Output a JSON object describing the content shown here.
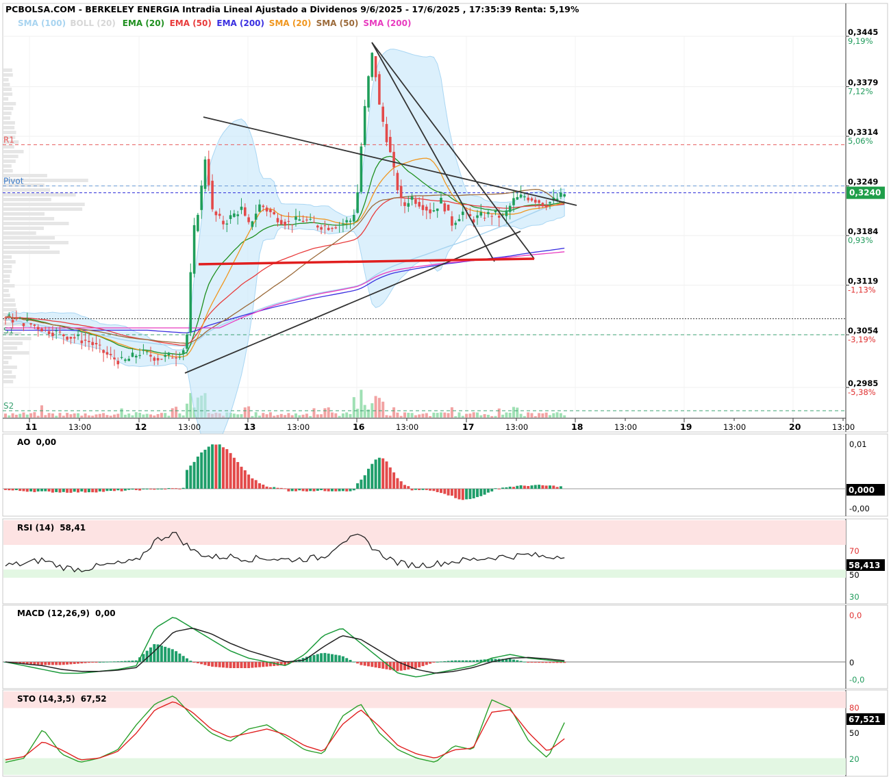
{
  "title": "PCBOLSA.COM - BERKELEY ENERGIA Intradia Lineal Ajustado a Dividenos 9/6/2025 - 17/6/2025 , 17:35:39 Renta: 5,19%",
  "legend": [
    {
      "label": "SMA (100)",
      "color": "#a8d4f0"
    },
    {
      "label": "BOLL (20)",
      "color": "#d7d7d7"
    },
    {
      "label": "EMA (20)",
      "color": "#1e8f1e"
    },
    {
      "label": "EMA (50)",
      "color": "#e83b3b"
    },
    {
      "label": "EMA (200)",
      "color": "#3a2fe0"
    },
    {
      "label": "SMA (20)",
      "color": "#f0961e"
    },
    {
      "label": "SMA (50)",
      "color": "#9b6a3a"
    },
    {
      "label": "SMA (200)",
      "color": "#e83bbf"
    }
  ],
  "price_axis": [
    {
      "value": "0,3445",
      "pct": "9,19%",
      "pct_color": "#1e9a5a"
    },
    {
      "value": "0,3379",
      "pct": "7,12%",
      "pct_color": "#1e9a5a"
    },
    {
      "value": "0,3314",
      "pct": "5,06%",
      "pct_color": "#1e9a5a"
    },
    {
      "value": "0,3249",
      "pct": "",
      "pct_color": "#1e9a5a"
    },
    {
      "value": "0,3184",
      "pct": "0,93%",
      "pct_color": "#1e9a5a"
    },
    {
      "value": "0,3119",
      "pct": "-1,13%",
      "pct_color": "#e03030"
    },
    {
      "value": "0,3054",
      "pct": "-3,19%",
      "pct_color": "#e03030"
    },
    {
      "value": "0,2985",
      "pct": "-5,38%",
      "pct_color": "#e03030"
    }
  ],
  "last_price_tag": "0,3240",
  "levels": {
    "r1": "R1",
    "pivot": "Pivot",
    "s1": "S1",
    "s2": "S2"
  },
  "x_axis": {
    "days": [
      "11",
      "12",
      "13",
      "16",
      "17",
      "18",
      "19",
      "20"
    ],
    "time_label": "13:00"
  },
  "panels": {
    "ao": {
      "label": "AO",
      "value": "0,00",
      "axis_top": "0,01",
      "axis_bottom": "-0,00",
      "tag": "0,000"
    },
    "rsi": {
      "label": "RSI (14)",
      "value": "58,41",
      "axis_70": "70",
      "axis_50": "50",
      "axis_30": "30",
      "tag": "58,413"
    },
    "macd": {
      "label": "MACD (12,26,9)",
      "value": "0,00",
      "axis_top": "0,0",
      "axis_mid": "0",
      "axis_bottom": "-0,0"
    },
    "sto": {
      "label": "STO (14,3,5)",
      "value": "67,52",
      "axis_80": "80",
      "axis_50": "50",
      "axis_20": "20",
      "tag": "67,521"
    }
  },
  "chart_data": [
    {
      "type": "candlestick",
      "title": "PCBOLSA.COM - BERKELEY ENERGIA Intradia Lineal Ajustado a Dividenos 9/6/2025 - 17/6/2025 , 17:35:39 Renta: 5,19%",
      "x_range": [
        "11",
        "20"
      ],
      "y_range": [
        0.2985,
        0.3445
      ],
      "last_price": 0.324,
      "levels": {
        "R1": 0.3303,
        "Pivot": 0.3249,
        "S1": 0.3054,
        "S2": 0.2985
      },
      "series": [
        {
          "name": "Close",
          "values": [
            0.3077,
            0.3068,
            0.3051,
            0.3042,
            0.3023,
            0.3014,
            0.3036,
            0.3051,
            0.3182,
            0.3271,
            0.3217,
            0.3199,
            0.3211,
            0.3226,
            0.3222,
            0.3208,
            0.3205,
            0.3219,
            0.3342,
            0.3387,
            0.3311,
            0.3276,
            0.3233,
            0.3226,
            0.3215,
            0.3203,
            0.3221,
            0.3217,
            0.3236,
            0.3233,
            0.324
          ]
        }
      ]
    },
    {
      "type": "bar",
      "title": "AO",
      "value": 0.0,
      "ylim": [
        -0.005,
        0.01
      ]
    },
    {
      "type": "line",
      "title": "RSI (14)",
      "value": 58.41,
      "ylim": [
        0,
        100
      ],
      "values": [
        45,
        47,
        52,
        43,
        40,
        44,
        47,
        50,
        75,
        85,
        63,
        55,
        56,
        53,
        54,
        52,
        53,
        55,
        75,
        80,
        60,
        48,
        45,
        47,
        50,
        52,
        55,
        56,
        58,
        55,
        58.41
      ]
    },
    {
      "type": "line",
      "title": "MACD (12,26,9)",
      "value": 0.0,
      "series": [
        {
          "name": "MACD",
          "values": [
            0,
            -0.1,
            -0.2,
            -0.3,
            -0.3,
            -0.25,
            -0.2,
            -0.1,
            0.9,
            1.2,
            0.9,
            0.6,
            0.3,
            0.1,
            0,
            -0.1,
            0.2,
            0.7,
            0.9,
            0.5,
            0.1,
            -0.3,
            -0.4,
            -0.3,
            -0.2,
            -0.1,
            0.1,
            0.2,
            0.1,
            0.05,
            0
          ]
        },
        {
          "name": "Signal",
          "values": [
            0,
            -0.05,
            -0.1,
            -0.2,
            -0.25,
            -0.25,
            -0.22,
            -0.15,
            0.3,
            0.8,
            0.9,
            0.75,
            0.5,
            0.3,
            0.15,
            0,
            0.05,
            0.4,
            0.7,
            0.6,
            0.3,
            0,
            -0.2,
            -0.3,
            -0.25,
            -0.15,
            0,
            0.1,
            0.12,
            0.08,
            0.03
          ]
        }
      ]
    },
    {
      "type": "line",
      "title": "STO (14,3,5)",
      "value": 67.52,
      "ylim": [
        0,
        100
      ],
      "series": [
        {
          "name": "%K",
          "values": [
            15,
            20,
            55,
            25,
            15,
            20,
            30,
            60,
            85,
            95,
            70,
            50,
            40,
            55,
            60,
            45,
            30,
            25,
            70,
            85,
            50,
            30,
            20,
            15,
            35,
            30,
            90,
            80,
            40,
            20,
            67.52
          ]
        },
        {
          "name": "%D",
          "values": [
            18,
            22,
            40,
            30,
            18,
            20,
            28,
            50,
            78,
            88,
            75,
            55,
            45,
            50,
            55,
            48,
            35,
            28,
            60,
            78,
            58,
            35,
            25,
            20,
            30,
            32,
            75,
            78,
            50,
            28,
            45
          ]
        }
      ]
    }
  ]
}
